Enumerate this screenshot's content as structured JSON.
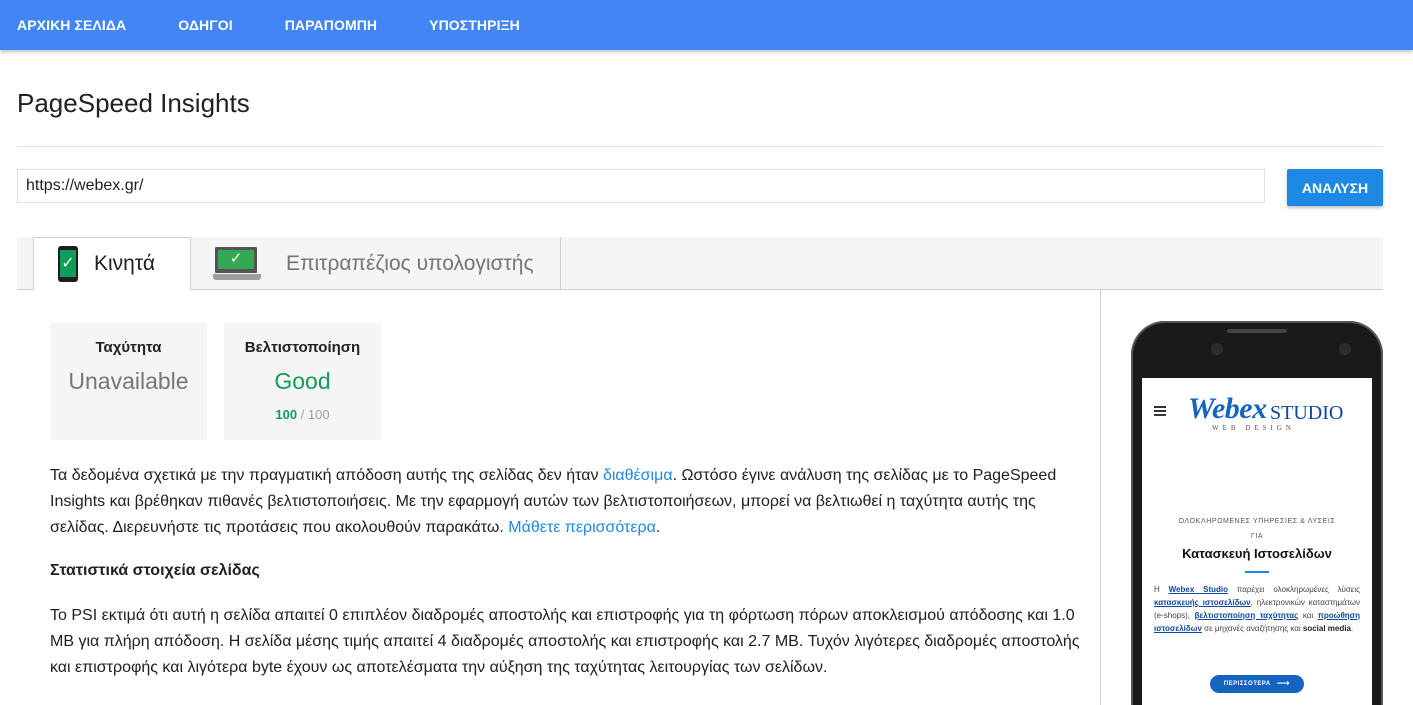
{
  "nav": {
    "items": [
      {
        "label": "ΑΡΧΙΚΗ ΣΕΛΙΔΑ"
      },
      {
        "label": "ΟΔΗΓΟΙ"
      },
      {
        "label": "ΠΑΡΑΠΟΜΠΗ"
      },
      {
        "label": "ΥΠΟΣΤΗΡΙΞΗ"
      }
    ]
  },
  "page": {
    "title": "PageSpeed Insights"
  },
  "form": {
    "url_value": "https://webex.gr/",
    "analyze_label": "ΑΝΑΛΥΣΗ"
  },
  "tabs": {
    "mobile": {
      "label": "Κινητά",
      "active": true
    },
    "desktop": {
      "label": "Επιτραπέζιος υπολογιστής",
      "active": false
    }
  },
  "scores": {
    "speed": {
      "label": "Ταχύτητα",
      "value": "Unavailable"
    },
    "optimization": {
      "label": "Βελτιστοποίηση",
      "value": "Good",
      "score": "100",
      "max": "/ 100"
    }
  },
  "summary": {
    "text_a": "Τα δεδομένα σχετικά με την πραγματική απόδοση αυτής της σελίδας δεν ήταν ",
    "link_available": "διαθέσιμα",
    "text_b": ". Ωστόσο έγινε ανάλυση της σελίδας με το PageSpeed Insights και βρέθηκαν πιθανές βελτιστοποιήσεις. Με την εφαρμογή αυτών των βελτιστοποιήσεων, μπορεί να βελτιωθεί η ταχύτητα αυτής της σελίδας. Διερευνήστε τις προτάσεις που ακολουθούν παρακάτω. ",
    "link_learn_more": "Μάθετε περισσότερα",
    "text_c": "."
  },
  "stats": {
    "heading": "Στατιστικά στοιχεία σελίδας",
    "text": "Το PSI εκτιμά ότι αυτή η σελίδα απαιτεί 0 επιπλέον διαδρομές αποστολής και επιστροφής για τη φόρτωση πόρων αποκλεισμού απόδοσης και 1.0 MB για πλήρη απόδοση. Η σελίδα μέσης τιμής απαιτεί 4 διαδρομές αποστολής και επιστροφής και 2.7 MB. Τυχόν λιγότερες διαδρομές αποστολής και επιστροφής και λιγότερα byte έχουν ως αποτελέσματα την αύξηση της ταχύτητας λειτουργίας των σελίδων."
  },
  "preview": {
    "logo_script": "Webex",
    "logo_studio": "STUDIO",
    "logo_sub": "WEB DESIGN",
    "services": "ΟΛΟΚΛΗΡΩΜΕΝΕΣ ΥΠΗΡΕΣΙΕΣ & ΛΥΣΕΙΣ",
    "for": "ΓΙΑ",
    "headline": "Κατασκευή Ιστοσελίδων",
    "body_1": "Η ",
    "body_brand": "Webex Studio",
    "body_2": " παρέχει ολοκληρωμένες λύσεις ",
    "body_link1": "κατασκευής ιστοσελίδων",
    "body_3": ", ηλεκτρονικών καταστημάτων (e-shops), ",
    "body_link2": "βελτιστοποίηση ταχύτητας",
    "body_4": " και ",
    "body_link3": "προώθηση ιστοσελίδων",
    "body_5": " σε μηχανές αναζήτησης και ",
    "body_social": "social media",
    "body_6": ".",
    "more_label": "ΠΕΡΙΣΣΟΤΕΡΑ"
  },
  "colors": {
    "nav_bg": "#4285f4",
    "button_bg": "#1e88e5",
    "good": "#0f9d58",
    "link": "#1e88e5"
  }
}
